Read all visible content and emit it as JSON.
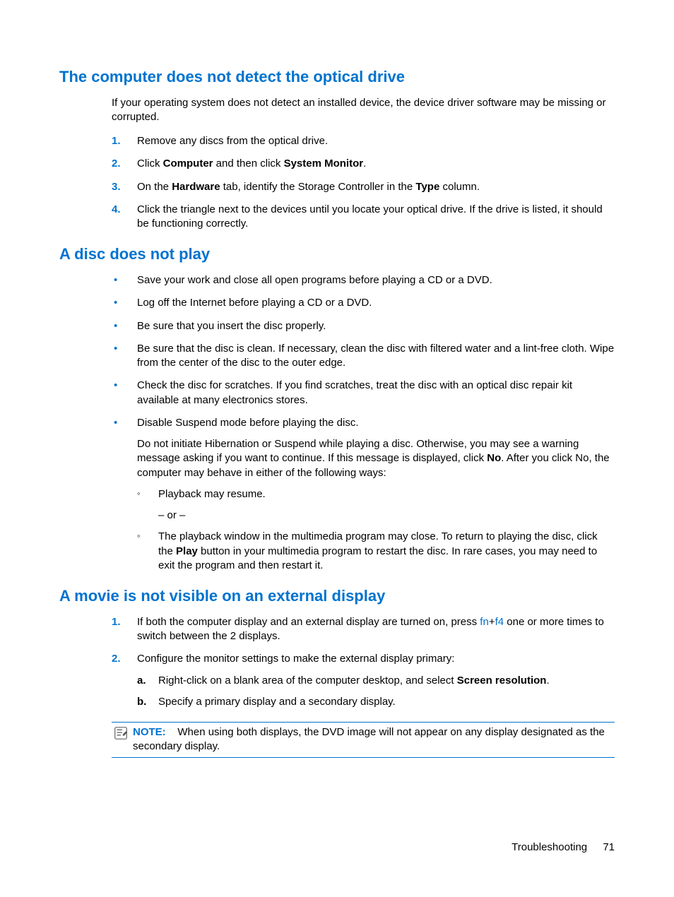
{
  "section1": {
    "heading": "The computer does not detect the optical drive",
    "intro": "If your operating system does not detect an installed device, the device driver software may be missing or corrupted.",
    "steps": [
      {
        "n": "1.",
        "parts": [
          "Remove any discs from the optical drive."
        ]
      },
      {
        "n": "2.",
        "parts": [
          "Click ",
          "Computer",
          " and then click ",
          "System Monitor",
          "."
        ]
      },
      {
        "n": "3.",
        "parts": [
          "On the ",
          "Hardware",
          " tab, identify the Storage Controller in the ",
          "Type",
          " column."
        ]
      },
      {
        "n": "4.",
        "parts": [
          "Click the triangle next to the devices until you locate your optical drive. If the drive is listed, it should be functioning correctly."
        ]
      }
    ]
  },
  "section2": {
    "heading": "A disc does not play",
    "bullets": [
      "Save your work and close all open programs before playing a CD or a DVD.",
      "Log off the Internet before playing a CD or a DVD.",
      "Be sure that you insert the disc properly.",
      "Be sure that the disc is clean. If necessary, clean the disc with filtered water and a lint-free cloth. Wipe from the center of the disc to the outer edge.",
      "Check the disc for scratches. If you find scratches, treat the disc with an optical disc repair kit available at many electronics stores."
    ],
    "bullet6": {
      "text": "Disable Suspend mode before playing the disc.",
      "sub_para_parts": [
        "Do not initiate Hibernation or Suspend while playing a disc. Otherwise, you may see a warning message asking if you want to continue. If this message is displayed, click ",
        "No",
        ". After you click No, the computer may behave in either of the following ways:"
      ],
      "sub1": "Playback may resume.",
      "or": "– or –",
      "sub2_parts": [
        "The playback window in the multimedia program may close. To return to playing the disc, click the ",
        "Play",
        " button in your multimedia program to restart the disc. In rare cases, you may need to exit the program and then restart it."
      ]
    }
  },
  "section3": {
    "heading": "A movie is not visible on an external display",
    "steps": [
      {
        "n": "1.",
        "pre": "If both the computer display and an external display are turned on, press ",
        "key1": "fn",
        "plus": "+",
        "key2": "f4",
        "post": " one or more times to switch between the 2 displays."
      },
      {
        "n": "2.",
        "text": "Configure the monitor settings to make the external display primary:",
        "alpha": [
          {
            "a": "a.",
            "parts": [
              "Right-click on a blank area of the computer desktop, and select ",
              "Screen resolution",
              "."
            ]
          },
          {
            "a": "b.",
            "parts": [
              "Specify a primary display and a secondary display."
            ]
          }
        ]
      }
    ],
    "note": {
      "label": "NOTE:",
      "text": "When using both displays, the DVD image will not appear on any display designated as the secondary display."
    }
  },
  "footer": {
    "section": "Troubleshooting",
    "page": "71"
  }
}
